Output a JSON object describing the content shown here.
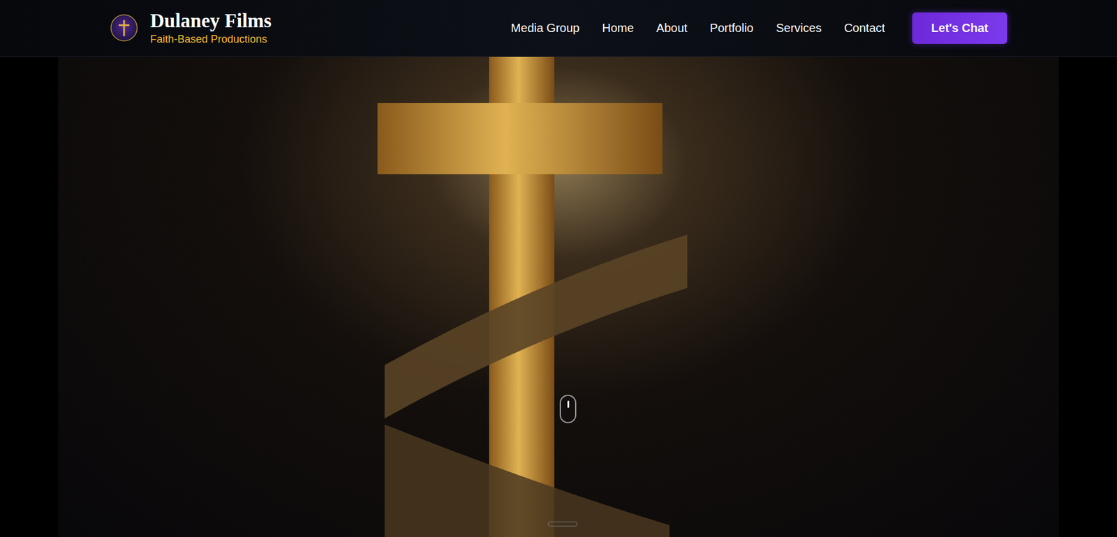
{
  "header": {
    "brand": {
      "title": "Dulaney Films",
      "tagline": "Faith-Based Productions"
    },
    "nav": [
      {
        "label": "Media Group"
      },
      {
        "label": "Home"
      },
      {
        "label": "About"
      },
      {
        "label": "Portfolio"
      },
      {
        "label": "Services"
      },
      {
        "label": "Contact"
      }
    ],
    "cta": "Let's Chat"
  },
  "hero": {
    "image": "cross-film-strip-photo"
  }
}
